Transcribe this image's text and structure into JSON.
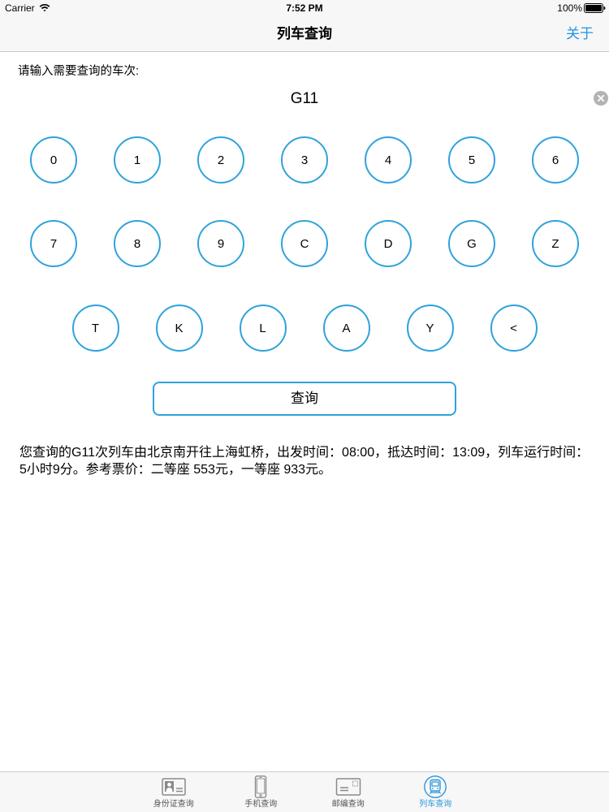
{
  "status_bar": {
    "carrier": "Carrier",
    "time": "7:52 PM",
    "battery_level": "100%",
    "icons": {
      "wifi": "wifi-icon",
      "battery": "battery-icon"
    }
  },
  "nav_bar": {
    "title": "列车查询",
    "right_button": "关于"
  },
  "train_search": {
    "prompt": "请输入需要查询的车次:",
    "value": "G11",
    "clear_icon": "clear-icon"
  },
  "keypad": {
    "rows": [
      [
        "0",
        "1",
        "2",
        "3",
        "4",
        "5",
        "6"
      ],
      [
        "7",
        "8",
        "9",
        "C",
        "D",
        "G",
        "Z"
      ],
      [
        "T",
        "K",
        "L",
        "A",
        "Y",
        "<"
      ]
    ]
  },
  "query_button": {
    "label": "查询"
  },
  "result": {
    "text": "您查询的G11次列车由北京南开往上海虹桥，出发时间：08:00，抵达时间：13:09，列车运行时间：5小时9分。参考票价：二等座 553元，一等座 933元。"
  },
  "tab_bar": {
    "items": [
      {
        "label": "身份证查询",
        "icon": "id-card-icon",
        "selected": false
      },
      {
        "label": "手机查询",
        "icon": "phone-icon",
        "selected": false
      },
      {
        "label": "邮编查询",
        "icon": "postcard-icon",
        "selected": false
      },
      {
        "label": "列车查询",
        "icon": "train-icon",
        "selected": true
      }
    ]
  },
  "colors": {
    "accent": "#2ea3db",
    "link": "#1f93e6",
    "tab_selected": "#2b97dc",
    "tab_icon": "#8a8a8a",
    "tab_label": "#555555",
    "bar_background": "#f7f7f7"
  }
}
